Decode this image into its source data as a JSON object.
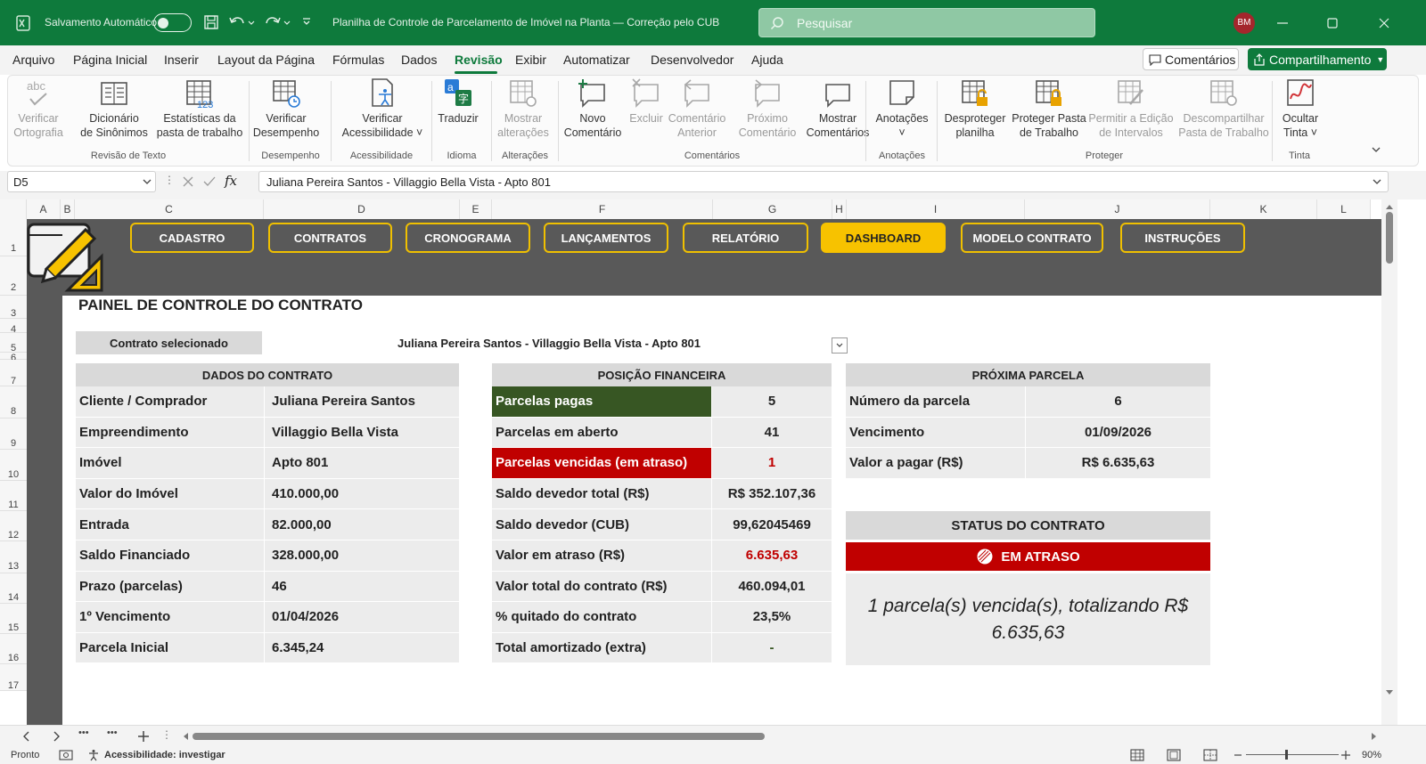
{
  "titlebar": {
    "autosave_label": "Salvamento Automático",
    "doc_title": "Planilha de Controle de Parcelamento de Imóvel na Planta — Correção pelo CUB",
    "search_placeholder": "Pesquisar",
    "user_initials": "BM"
  },
  "menu": {
    "items": [
      "Arquivo",
      "Página Inicial",
      "Inserir",
      "Layout da Página",
      "Fórmulas",
      "Dados",
      "Revisão",
      "Exibir",
      "Automatizar",
      "Desenvolvedor",
      "Ajuda"
    ],
    "active": "Revisão",
    "comments_btn": "Comentários",
    "share_btn": "Compartilhamento"
  },
  "ribbon": {
    "buttons": [
      {
        "l1": "Verificar",
        "l2": "Ortografia",
        "icon": "spellcheck-icon",
        "disabled": true
      },
      {
        "l1": "Dicionário",
        "l2": "de Sinônimos",
        "icon": "thesaurus-icon",
        "disabled": false
      },
      {
        "l1": "Estatísticas da",
        "l2": "pasta de trabalho",
        "icon": "workbook-stats-icon",
        "disabled": false
      },
      {
        "l1": "Verificar",
        "l2": "Desempenho",
        "icon": "performance-icon",
        "disabled": false
      },
      {
        "l1": "Verificar",
        "l2": "Acessibilidade ˅",
        "icon": "accessibility-icon",
        "disabled": false
      },
      {
        "l1": "Traduzir",
        "l2": "",
        "icon": "translate-icon",
        "disabled": false
      },
      {
        "l1": "Mostrar",
        "l2": "alterações",
        "icon": "show-changes-icon",
        "disabled": true
      },
      {
        "l1": "Novo",
        "l2": "Comentário",
        "icon": "new-comment-icon",
        "disabled": false
      },
      {
        "l1": "Excluir",
        "l2": "",
        "icon": "delete-comment-icon",
        "disabled": true
      },
      {
        "l1": "Comentário",
        "l2": "Anterior",
        "icon": "prev-comment-icon",
        "disabled": true
      },
      {
        "l1": "Próximo",
        "l2": "Comentário",
        "icon": "next-comment-icon",
        "disabled": true
      },
      {
        "l1": "Mostrar",
        "l2": "Comentários",
        "icon": "show-comments-icon",
        "disabled": false
      },
      {
        "l1": "Anotações",
        "l2": "˅",
        "icon": "notes-icon",
        "disabled": false
      },
      {
        "l1": "Desproteger",
        "l2": "planilha",
        "icon": "unprotect-sheet-icon",
        "disabled": false
      },
      {
        "l1": "Proteger Pasta",
        "l2": "de Trabalho",
        "icon": "protect-workbook-icon",
        "disabled": false
      },
      {
        "l1": "Permitir a Edição",
        "l2": "de Intervalos",
        "icon": "allow-edit-ranges-icon",
        "disabled": true
      },
      {
        "l1": "Descompartilhar",
        "l2": "Pasta de Trabalho",
        "icon": "unshare-workbook-icon",
        "disabled": true
      },
      {
        "l1": "Ocultar",
        "l2": "Tinta ˅",
        "icon": "hide-ink-icon",
        "disabled": false
      }
    ],
    "groups": [
      "Revisão de Texto",
      "Desempenho",
      "Acessibilidade",
      "Idioma",
      "Alterações",
      "Comentários",
      "Anotações",
      "Proteger",
      "Tinta"
    ]
  },
  "formula": {
    "namebox": "D5",
    "fx": "fx",
    "value": "Juliana Pereira Santos - Villaggio Bella Vista - Apto 801"
  },
  "columns": [
    "A",
    "B",
    "C",
    "D",
    "E",
    "F",
    "G",
    "H",
    "I",
    "J",
    "K",
    "L"
  ],
  "rows": [
    "1",
    "2",
    "3",
    "4",
    "5",
    "6",
    "7",
    "8",
    "9",
    "10",
    "11",
    "12",
    "13",
    "14",
    "15",
    "16",
    "17"
  ],
  "nav": [
    "CADASTRO",
    "CONTRATOS",
    "CRONOGRAMA",
    "LANÇAMENTOS",
    "RELATÓRIO",
    "DASHBOARD",
    "MODELO CONTRATO",
    "INSTRUÇÕES"
  ],
  "nav_active": "DASHBOARD",
  "dashboard": {
    "title": "PAINEL DE CONTROLE DO CONTRATO",
    "selected_label": "Contrato selecionado",
    "selected_value": "Juliana Pereira Santos - Villaggio Bella Vista - Apto 801",
    "contract_header": "DADOS DO CONTRATO",
    "contract": [
      {
        "k": "Cliente / Comprador",
        "v": "Juliana Pereira Santos"
      },
      {
        "k": "Empreendimento",
        "v": "Villaggio Bella Vista"
      },
      {
        "k": "Imóvel",
        "v": "Apto 801"
      },
      {
        "k": "Valor do Imóvel",
        "v": "410.000,00"
      },
      {
        "k": "Entrada",
        "v": "82.000,00"
      },
      {
        "k": "Saldo Financiado",
        "v": "328.000,00"
      },
      {
        "k": "Prazo (parcelas)",
        "v": "46"
      },
      {
        "k": "1º Vencimento",
        "v": "01/04/2026"
      },
      {
        "k": "Parcela Inicial",
        "v": "6.345,24"
      }
    ],
    "finance_header": "POSIÇÃO FINANCEIRA",
    "finance": [
      {
        "k": "Parcelas pagas",
        "v": "5"
      },
      {
        "k": "Parcelas em aberto",
        "v": "41"
      },
      {
        "k": "Parcelas vencidas (em atraso)",
        "v": "1"
      },
      {
        "k": "Saldo devedor total (R$)",
        "v": "R$ 352.107,36"
      },
      {
        "k": "Saldo devedor (CUB)",
        "v": "99,62045469"
      },
      {
        "k": "Valor em atraso (R$)",
        "v": "6.635,63"
      },
      {
        "k": "Valor total do contrato (R$)",
        "v": "460.094,01"
      },
      {
        "k": "% quitado do contrato",
        "v": "23,5%"
      },
      {
        "k": "Total amortizado (extra)",
        "v": "-"
      }
    ],
    "next_header": "PRÓXIMA PARCELA",
    "next": [
      {
        "k": "Número da parcela",
        "v": "6"
      },
      {
        "k": "Vencimento",
        "v": "01/09/2026"
      },
      {
        "k": "Valor a pagar (R$)",
        "v": "R$ 6.635,63"
      }
    ],
    "status_header": "STATUS DO CONTRATO",
    "status_badge": "EM ATRASO",
    "status_line1": "1 parcela(s) vencida(s), totalizando R$",
    "status_line2": "6.635,63"
  },
  "sheetbar": {
    "nav_more": "•••"
  },
  "statusbar": {
    "ready": "Pronto",
    "accessibility": "Acessibilidade: investigar",
    "zoom": "90%"
  },
  "colors": {
    "excel_green": "#0e7a3c",
    "dark_green": "#375623",
    "red": "#c00000",
    "nav_yellow": "#f7c200",
    "dash_bg": "#595959"
  }
}
